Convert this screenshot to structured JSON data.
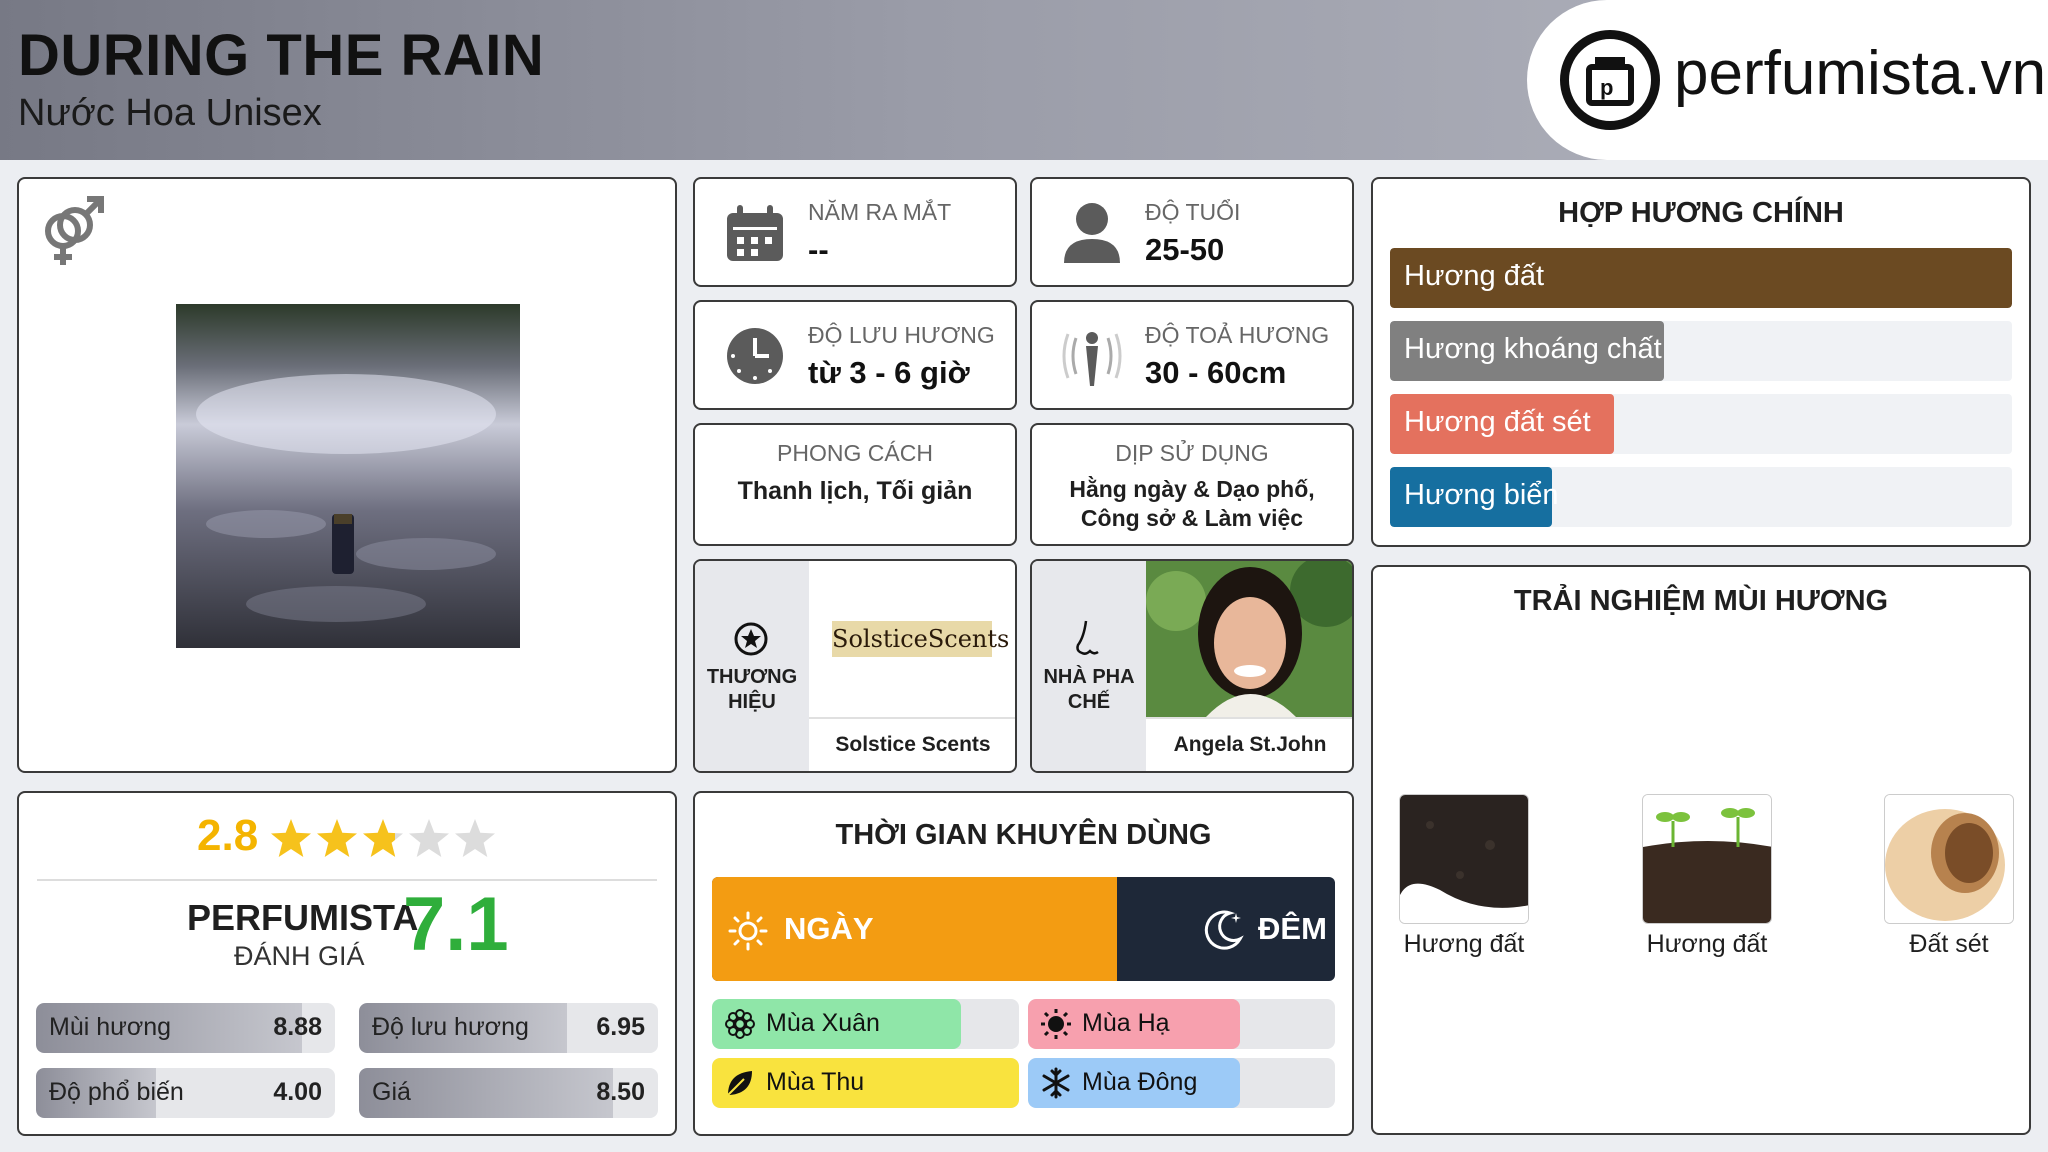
{
  "header": {
    "title": "DURING THE RAIN",
    "subtitle": "Nước Hoa Unisex",
    "logo_text": "perfumista.vn"
  },
  "info": {
    "launch_label": "NĂM RA MẮT",
    "launch_value": "--",
    "age_label": "ĐỘ TUỔI",
    "age_value": "25-50",
    "longevity_label": "ĐỘ LƯU HƯƠNG",
    "longevity_value": "từ 3 - 6 giờ",
    "sillage_label": "ĐỘ TOẢ HƯƠNG",
    "sillage_value": "30 - 60cm",
    "style_label": "PHONG CÁCH",
    "style_value": "Thanh lịch, Tối giản",
    "occasion_label": "DỊP SỬ DỤNG",
    "occasion_value": "Hằng ngày & Dạo phố, Công sở & Làm việc",
    "brand_label": "THƯƠNG HIỆU",
    "brand_logo_text": "SolsticeScents",
    "brand_name": "Solstice Scents",
    "perfumer_label": "NHÀ PHA CHẾ",
    "perfumer_name": "Angela St.John"
  },
  "accords": {
    "title": "HỢP HƯƠNG CHÍNH",
    "items": [
      {
        "label": "Hương đất",
        "percent": 100,
        "color": "#6b4a22"
      },
      {
        "label": "Hương khoáng chất",
        "percent": 44,
        "color": "#808080"
      },
      {
        "label": "Hương đất sét",
        "percent": 36,
        "color": "#e4715e"
      },
      {
        "label": "Hương biển",
        "percent": 26,
        "color": "#166fa0"
      }
    ]
  },
  "notes": {
    "title": "TRẢI NGHIỆM MÙI HƯƠNG",
    "items": [
      {
        "label": "Hương đất",
        "icon": "soil-icon"
      },
      {
        "label": "Hương đất",
        "icon": "sprout-soil-icon"
      },
      {
        "label": "Đất sét",
        "icon": "clay-pot-icon"
      }
    ]
  },
  "rating": {
    "score": "2.8",
    "stars": 2.8,
    "perfumista_label": "PERFUMISTA",
    "review_label": "ĐÁNH GIÁ",
    "perfumista_score": "7.1",
    "metrics": [
      {
        "label": "Mùi hương",
        "value": "8.88",
        "fraction": 0.888
      },
      {
        "label": "Độ lưu hương",
        "value": "6.95",
        "fraction": 0.695
      },
      {
        "label": "Độ phổ biến",
        "value": "4.00",
        "fraction": 0.4
      },
      {
        "label": "Giá",
        "value": "8.50",
        "fraction": 0.85
      }
    ]
  },
  "time": {
    "title": "THỜI GIAN KHUYÊN DÙNG",
    "day_label": "NGÀY",
    "night_label": "ĐÊM",
    "day_fraction": 0.65,
    "seasons": [
      {
        "label": "Mùa Xuân",
        "fraction": 0.81,
        "color": "#8fe6a8",
        "icon": "flower-icon"
      },
      {
        "label": "Mùa Hạ",
        "fraction": 0.69,
        "color": "#f7a0ae",
        "icon": "sun-icon"
      },
      {
        "label": "Mùa Thu",
        "fraction": 1.0,
        "color": "#f9e33e",
        "icon": "leaf-icon"
      },
      {
        "label": "Mùa Đông",
        "fraction": 0.69,
        "color": "#9ccaf7",
        "icon": "snowflake-icon"
      }
    ]
  },
  "colors": {
    "day": "#f39c12",
    "night": "#1e2838",
    "score_green": "#2fae3b",
    "score_gold": "#f4b400",
    "star": "#f6c21c"
  }
}
